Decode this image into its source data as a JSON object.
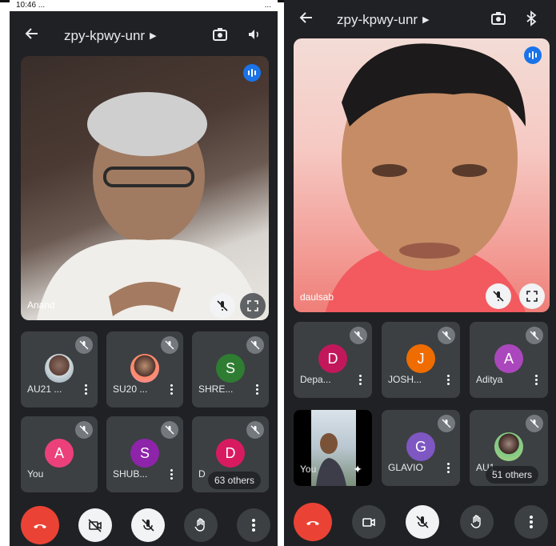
{
  "left": {
    "status": {
      "left": "10:46 ... ",
      "right": "... "
    },
    "header": {
      "title": "zpy-kpwy-unr"
    },
    "main_video": {
      "name": "Anand"
    },
    "tiles": [
      {
        "name": "AU21 ...",
        "avatar_type": "photo"
      },
      {
        "name": "SU20 ...",
        "avatar_type": "photo"
      },
      {
        "name": "SHRE...",
        "initial": "S",
        "color": "#2e7d32"
      },
      {
        "name": "You",
        "initial": "A",
        "color": "#ec407a"
      },
      {
        "name": "SHUB...",
        "initial": "S",
        "color": "#8e24aa"
      },
      {
        "name": "D",
        "initial": "D",
        "color": "#d81b60"
      }
    ],
    "others_label": "63 others"
  },
  "right": {
    "header": {
      "title": "zpy-kpwy-unr"
    },
    "main_video": {
      "name": "daulsab"
    },
    "tiles": [
      {
        "name": "Depa...",
        "initial": "D",
        "color": "#c2185b"
      },
      {
        "name": "JOSH...",
        "initial": "J",
        "color": "#ef6c00"
      },
      {
        "name": "Aditya",
        "initial": "A",
        "color": "#ab47bc"
      },
      {
        "name": "You",
        "avatar_type": "self-video"
      },
      {
        "name": "GLAVIO",
        "initial": "G",
        "color": "#7e57c2"
      },
      {
        "name": "AU1",
        "avatar_type": "photo"
      }
    ],
    "others_label": "51 others"
  },
  "icons": {
    "back": "arrow-left-icon",
    "switch_camera": "switch-camera-icon",
    "speaker": "speaker-icon",
    "bluetooth": "bluetooth-icon",
    "mic_off": "mic-off-icon",
    "fullscreen": "fullscreen-icon",
    "end_call": "phone-hangup-icon",
    "camera": "camera-icon",
    "raise_hand": "hand-icon",
    "more": "more-vert-icon"
  }
}
